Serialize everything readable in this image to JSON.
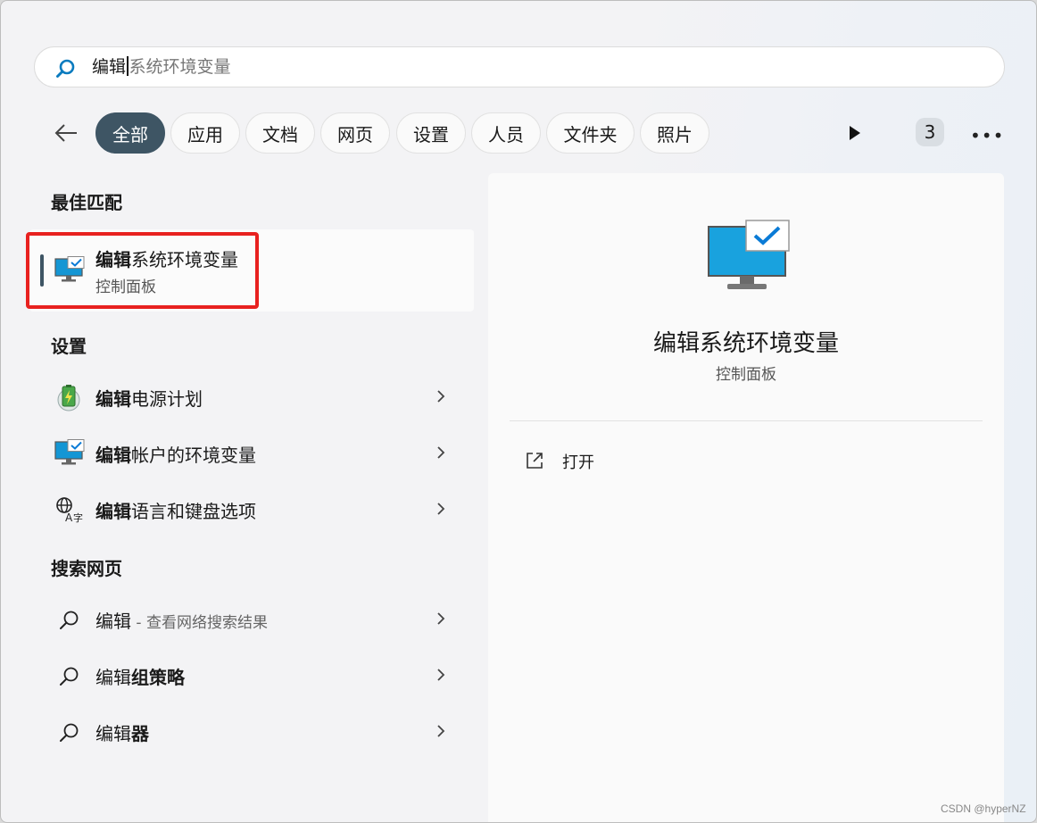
{
  "search": {
    "typed": "编辑",
    "suggestion": "系统环境变量"
  },
  "filters": {
    "items": [
      {
        "label": "全部",
        "active": true
      },
      {
        "label": "应用"
      },
      {
        "label": "文档"
      },
      {
        "label": "网页"
      },
      {
        "label": "设置"
      },
      {
        "label": "人员"
      },
      {
        "label": "文件夹"
      },
      {
        "label": "照片"
      }
    ],
    "count_badge": "3",
    "more_label": "•••"
  },
  "sections": {
    "best_match": "最佳匹配",
    "settings": "设置",
    "web": "搜索网页"
  },
  "best_match": {
    "bold": "编辑",
    "rest": "系统环境变量",
    "subtitle": "控制面板"
  },
  "settings_items": [
    {
      "bold": "编辑",
      "rest": "电源计划"
    },
    {
      "bold": "编辑",
      "rest": "帐户的环境变量"
    },
    {
      "bold": "编辑",
      "rest": "语言和键盘选项"
    }
  ],
  "web_items": [
    {
      "normal": "编辑",
      "suffix": " - 查看网络搜索结果"
    },
    {
      "normal": "编辑",
      "bold": "组策略"
    },
    {
      "normal": "编辑",
      "bold": "器"
    }
  ],
  "detail": {
    "title": "编辑系统环境变量",
    "subtitle": "控制面板",
    "action": "打开"
  },
  "watermark": "CSDN @hyperNZ"
}
